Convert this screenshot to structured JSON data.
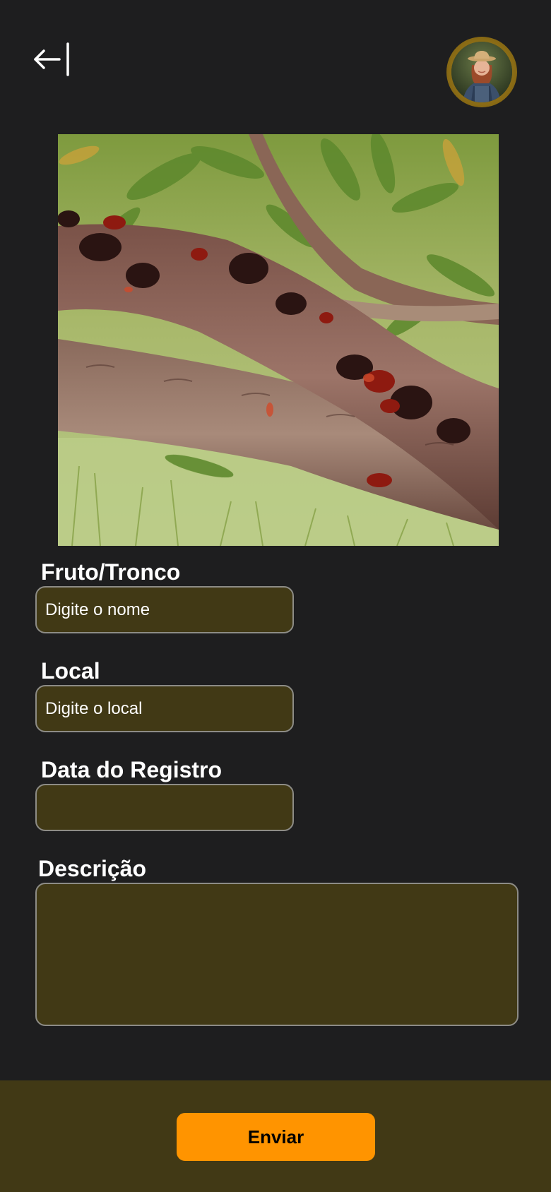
{
  "header": {
    "back_icon": "arrow-left-to-bar-icon",
    "avatar_icon": "user-avatar"
  },
  "photo": {
    "subject": "tree-branch-with-gum-photo"
  },
  "form": {
    "name": {
      "label": "Fruto/Tronco",
      "placeholder": "Digite o nome",
      "value": ""
    },
    "location": {
      "label": "Local",
      "placeholder": "Digite o local",
      "value": ""
    },
    "date": {
      "label": "Data do Registro",
      "placeholder": "",
      "value": ""
    },
    "description": {
      "label": "Descrição",
      "placeholder": "",
      "value": ""
    }
  },
  "footer": {
    "submit_label": "Enviar"
  },
  "colors": {
    "background": "#1e1e1f",
    "field_fill": "#413915",
    "field_border": "#8d8c86",
    "accent": "#ff9400",
    "avatar_ring": "#a17f1f"
  }
}
